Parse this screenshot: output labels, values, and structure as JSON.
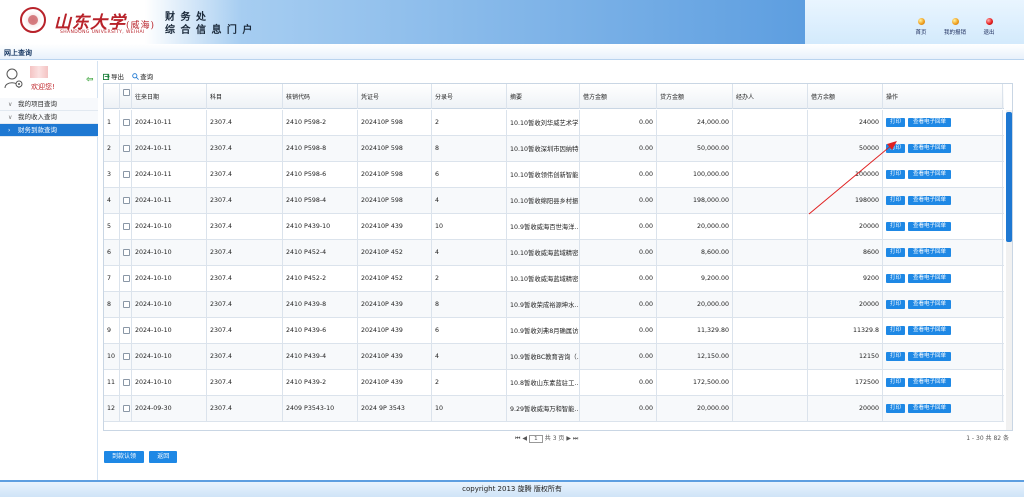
{
  "header": {
    "logo_text": "山东大学",
    "logo_campus": "(威海)",
    "logo_sub": "SHANDONG UNIVERSITY, WEIHAI",
    "title_line1": "财 务 处",
    "title_line2": "综 合 信 息 门 户",
    "links": [
      {
        "label": "首页",
        "icon": "home-dot-icon",
        "color": "#f0a020"
      },
      {
        "label": "我的报销",
        "icon": "report-dot-icon",
        "color": "#f0a020"
      },
      {
        "label": "退出",
        "icon": "logout-dot-icon",
        "color": "#e82020"
      }
    ]
  },
  "nav": {
    "tab": "网上查询"
  },
  "sidebar": {
    "welcome": "欢迎您!",
    "items": [
      {
        "label": "我的项目查询",
        "active": false
      },
      {
        "label": "我的收入查询",
        "active": false
      },
      {
        "label": "财务到款查询",
        "active": true
      }
    ]
  },
  "toolbar": {
    "export": "导出",
    "search": "查询"
  },
  "grid": {
    "columns": [
      "",
      "往来日期",
      "科目",
      "核销代码",
      "凭证号",
      "分录号",
      "摘要",
      "借方金额",
      "贷方金额",
      "经办人",
      "借方余额",
      "操作"
    ],
    "print_label": "打印",
    "receipt_label": "查看电子回单",
    "rows": [
      {
        "no": "1",
        "date": "2024-10-11",
        "subject": "2307.4",
        "code": "2410 P598-2",
        "voucher": "202410P  598",
        "entry": "2",
        "summary": "10.10暂收刘华威艺术学...",
        "debit": "0.00",
        "credit": "24,000.00",
        "handler": "",
        "balance": "24000"
      },
      {
        "no": "2",
        "date": "2024-10-11",
        "subject": "2307.4",
        "code": "2410 P598-8",
        "voucher": "202410P  598",
        "entry": "8",
        "summary": "10.10暂收深圳市因纳特...",
        "debit": "0.00",
        "credit": "50,000.00",
        "handler": "",
        "balance": "50000"
      },
      {
        "no": "3",
        "date": "2024-10-11",
        "subject": "2307.4",
        "code": "2410 P598-6",
        "voucher": "202410P  598",
        "entry": "6",
        "summary": "10.10暂收领伟创新智能...",
        "debit": "0.00",
        "credit": "100,000.00",
        "handler": "",
        "balance": "100000"
      },
      {
        "no": "4",
        "date": "2024-10-11",
        "subject": "2307.4",
        "code": "2410 P598-4",
        "voucher": "202410P  598",
        "entry": "4",
        "summary": "10.10暂收绵阳县乡村振...",
        "debit": "0.00",
        "credit": "198,000.00",
        "handler": "",
        "balance": "198000"
      },
      {
        "no": "5",
        "date": "2024-10-10",
        "subject": "2307.4",
        "code": "2410 P439-10",
        "voucher": "202410P  439",
        "entry": "10",
        "summary": "10.9暂收威海百世海洋...",
        "debit": "0.00",
        "credit": "20,000.00",
        "handler": "",
        "balance": "20000"
      },
      {
        "no": "6",
        "date": "2024-10-10",
        "subject": "2307.4",
        "code": "2410 P452-4",
        "voucher": "202410P  452",
        "entry": "4",
        "summary": "10.10暂收威海蓝域精密...",
        "debit": "0.00",
        "credit": "8,600.00",
        "handler": "",
        "balance": "8600"
      },
      {
        "no": "7",
        "date": "2024-10-10",
        "subject": "2307.4",
        "code": "2410 P452-2",
        "voucher": "202410P  452",
        "entry": "2",
        "summary": "10.10暂收威海蓝域精密...",
        "debit": "0.00",
        "credit": "9,200.00",
        "handler": "",
        "balance": "9200"
      },
      {
        "no": "8",
        "date": "2024-10-10",
        "subject": "2307.4",
        "code": "2410 P439-8",
        "voucher": "202410P  439",
        "entry": "8",
        "summary": "10.9暂收荣成裕源坤水...",
        "debit": "0.00",
        "credit": "20,000.00",
        "handler": "",
        "balance": "20000"
      },
      {
        "no": "9",
        "date": "2024-10-10",
        "subject": "2307.4",
        "code": "2410 P439-6",
        "voucher": "202410P  439",
        "entry": "6",
        "summary": "10.9暂收刘弗8月确属访...",
        "debit": "0.00",
        "credit": "11,329.80",
        "handler": "",
        "balance": "11329.8"
      },
      {
        "no": "10",
        "date": "2024-10-10",
        "subject": "2307.4",
        "code": "2410 P439-4",
        "voucher": "202410P  439",
        "entry": "4",
        "summary": "10.9暂收BC教育咨询（...",
        "debit": "0.00",
        "credit": "12,150.00",
        "handler": "",
        "balance": "12150"
      },
      {
        "no": "11",
        "date": "2024-10-10",
        "subject": "2307.4",
        "code": "2410 P439-2",
        "voucher": "202410P  439",
        "entry": "2",
        "summary": "10.8暂收山东素蓝驻工...",
        "debit": "0.00",
        "credit": "172,500.00",
        "handler": "",
        "balance": "172500"
      },
      {
        "no": "12",
        "date": "2024-09-30",
        "subject": "2307.4",
        "code": "2409 P3543-10",
        "voucher": "2024 9P  3543",
        "entry": "10",
        "summary": "9.29暂收威海万和智能...",
        "debit": "0.00",
        "credit": "20,000.00",
        "handler": "",
        "balance": "20000"
      }
    ]
  },
  "pager": {
    "first": "⏮",
    "prev": "◀",
    "page": "1",
    "total_pages": "共 3 页",
    "next": "▶",
    "last": "⏭",
    "summary": "1 - 30  共 82 条"
  },
  "actions": {
    "confirm": "到款认领",
    "back": "返回"
  },
  "footer": {
    "copyright": "copyright 2013 旋腾 版权所有"
  },
  "colors": {
    "accent": "#1e78d2",
    "button": "#1e88e5",
    "brand_red": "#b8222a"
  }
}
